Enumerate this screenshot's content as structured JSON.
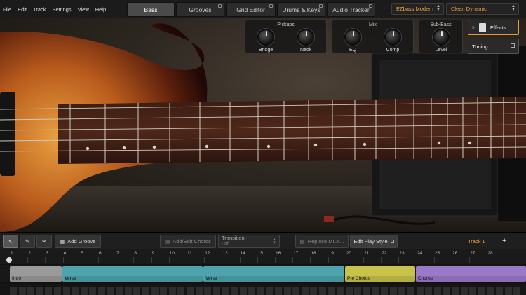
{
  "menu": [
    "File",
    "Edit",
    "Track",
    "Settings",
    "View",
    "Help"
  ],
  "tabs": [
    {
      "label": "Bass",
      "active": true
    },
    {
      "label": "Grooves",
      "active": false
    },
    {
      "label": "Grid Editor",
      "active": false
    },
    {
      "label": "Drums & Keys",
      "active": false
    },
    {
      "label": "Audio Tracker",
      "active": false
    }
  ],
  "instrument_select": "EZbass Modern",
  "preset_select": "Clean Dynamic",
  "pickups": {
    "title": "Pickups",
    "knobs": [
      "Bridge",
      "Neck"
    ]
  },
  "mix": {
    "title": "Mix",
    "knobs": [
      "EQ",
      "Comp"
    ]
  },
  "subbass": {
    "title": "Sub-Bass",
    "knobs": [
      "Level"
    ]
  },
  "effects_label": "Effects",
  "tuning_label": "Tuning",
  "toolbar": {
    "add_groove": "Add Groove",
    "add_edit_chords": "Add/Edit Chords",
    "transition_label": "Transition",
    "transition_value": "Off",
    "replace_midi": "Replace MIDI...",
    "edit_play_style": "Edit Play Style",
    "track_name": "Track 1",
    "add": "+"
  },
  "ruler": [
    "1",
    "2",
    "3",
    "4",
    "5",
    "6",
    "7",
    "8",
    "9",
    "10",
    "11",
    "12",
    "13",
    "14",
    "15",
    "16",
    "17",
    "18",
    "19",
    "20",
    "21",
    "22",
    "23",
    "24",
    "25",
    "26",
    "27",
    "28"
  ],
  "parts": [
    {
      "label": "Intro",
      "color": "#9a9a9a"
    },
    {
      "label": "Verse",
      "color": "#4fa3ad"
    },
    {
      "label": "Verse",
      "color": "#4fa3ad"
    },
    {
      "label": "Pre Chorus",
      "color": "#c9c24a"
    },
    {
      "label": "Chorus",
      "color": "#9b78c8"
    }
  ],
  "colors": {
    "accent": "#f0a13a"
  }
}
